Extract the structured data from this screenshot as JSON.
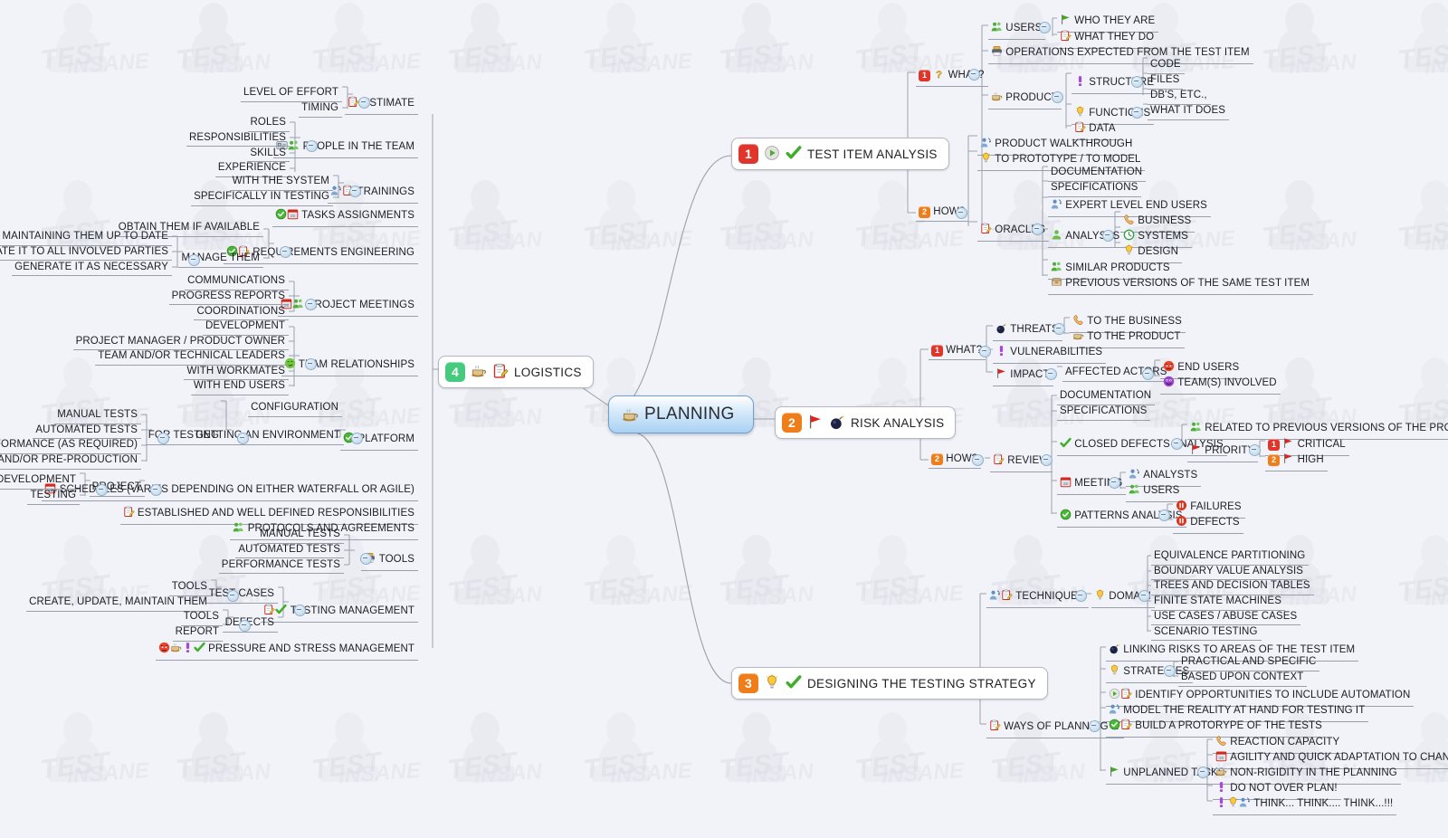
{
  "app": {
    "title": "PLANNING",
    "watermark_text": "TEST INSANE",
    "background_color": "#f2f3f8",
    "root_accent": "#a9d2f3"
  },
  "root": {
    "label": "PLANNING",
    "icon": "coffee-cup-icon"
  },
  "branches": [
    {
      "id": "test-item-analysis",
      "number": "1",
      "label": "TEST ITEM ANALYSIS",
      "icons": [
        "play-grey-icon",
        "check-green-icon"
      ],
      "badge_color": "#e0352b"
    },
    {
      "id": "risk-analysis",
      "number": "2",
      "label": "RISK ANALYSIS",
      "icons": [
        "flag-red-icon",
        "bomb-icon"
      ],
      "badge_color": "#ef7d1a"
    },
    {
      "id": "designing-the-testing-strategy",
      "number": "3",
      "label": "DESIGNING THE TESTING STRATEGY",
      "icons": [
        "lightbulb-icon",
        "check-green-icon"
      ],
      "badge_color": "#ef7d1a"
    },
    {
      "id": "logistics",
      "number": "4",
      "label": "LOGISTICS",
      "icons": [
        "coffee-cup-icon",
        "clipboard-icon"
      ],
      "badge_color": "#46cb7e"
    }
  ],
  "test_item_analysis": {
    "what": {
      "number": "1",
      "label": "WHAT?",
      "icon": "question-yellow-icon"
    },
    "users": {
      "label": "USERS",
      "icon": "users-green-icon"
    },
    "users_children": [
      {
        "label": "WHO THEY ARE",
        "icon": "flag-green-icon"
      },
      {
        "label": "WHAT THEY DO",
        "icon": "clipboard-icon"
      }
    ],
    "operations": {
      "label": "OPERATIONS EXPECTED FROM THE TEST ITEM",
      "icon": "printer-icon"
    },
    "product": {
      "label": "PRODUCT",
      "icon": "coffee-cup-icon"
    },
    "structure": {
      "label": "STRUCTURE",
      "icon": "exclam-purple-icon"
    },
    "structure_children": [
      {
        "label": "CODE"
      },
      {
        "label": "FILES"
      },
      {
        "label": "DB'S, ETC.,"
      }
    ],
    "functions": {
      "label": "FUNCTIONS",
      "icon": "lightbulb-icon"
    },
    "functions_children": [
      {
        "label": "WHAT IT DOES"
      }
    ],
    "data": {
      "label": "DATA",
      "icon": "clipboard-icon"
    },
    "how": {
      "number": "2",
      "label": "HOW?",
      "icon": "none"
    },
    "how_children": [
      {
        "label": "PRODUCT WALKTHROUGH",
        "icon": "presenter-icon"
      },
      {
        "label": "TO PROTOTYPE / TO MODEL",
        "icon": "lightbulb-icon"
      }
    ],
    "oracles": {
      "label": "ORACLES",
      "icon": "clipboard-icon"
    },
    "oracles_children": [
      {
        "label": "DOCUMENTATION",
        "icon": "none"
      },
      {
        "label": "SPECIFICATIONS",
        "icon": "none"
      },
      {
        "label": "EXPERT LEVEL END USERS",
        "icon": "presenter-icon"
      },
      {
        "label": "ANALYSTS",
        "icon": "person-green-icon"
      },
      {
        "label": "SIMILAR PRODUCTS",
        "icon": "users-green-icon"
      },
      {
        "label": "PREVIOUS VERSIONS OF THE SAME TEST ITEM",
        "icon": "archive-icon"
      }
    ],
    "analysts_children": [
      {
        "label": "BUSINESS",
        "icon": "phone-icon"
      },
      {
        "label": "SYSTEMS",
        "icon": "clock-green-icon"
      },
      {
        "label": "DESIGN",
        "icon": "lightbulb-icon"
      }
    ]
  },
  "risk_analysis": {
    "what": {
      "number": "1",
      "label": "WHAT?"
    },
    "threats": {
      "label": "THREATS",
      "icon": "bomb-icon"
    },
    "threats_children": [
      {
        "label": "TO THE BUSINESS",
        "icon": "phone-icon"
      },
      {
        "label": "TO THE PRODUCT",
        "icon": "coffee-cup-icon"
      }
    ],
    "vulnerabilities": {
      "label": "VULNERABILITIES",
      "icon": "exclam-purple-icon"
    },
    "impact": {
      "label": "IMPACT",
      "icon": "flag-red-icon"
    },
    "affected_actors": {
      "label": "AFFECTED ACTORS"
    },
    "affected_actors_children": [
      {
        "label": "END USERS",
        "icon": "smiley-angry-icon"
      },
      {
        "label": "TEAM(S) INVOLVED",
        "icon": "smiley-purple-icon"
      }
    ],
    "how": {
      "number": "2",
      "label": "HOW?"
    },
    "review": {
      "label": "REVIEW",
      "icon": "clipboard-icon"
    },
    "review_children": [
      {
        "label": "DOCUMENTATION",
        "icon": "none"
      },
      {
        "label": "SPECIFICATIONS",
        "icon": "none"
      },
      {
        "label": "CLOSED DEFECTS ANALYSIS",
        "icon": "check-green-icon"
      },
      {
        "label": "MEETING",
        "icon": "calendar-icon"
      },
      {
        "label": "PATTERNS ANALYSIS",
        "icon": "check-circle-green-icon"
      }
    ],
    "closed_defects_children": [
      {
        "label": "RELATED TO PREVIOUS VERSIONS OF THE PRODUCT",
        "icon": "users-green-icon"
      },
      {
        "label": "PRIORITY",
        "icon": "flag-red-icon"
      }
    ],
    "priority_children": [
      {
        "number": "1",
        "label": "CRITICAL",
        "icon": "flag-red-icon",
        "badge_color": "#e0352b"
      },
      {
        "number": "2",
        "label": "HIGH",
        "icon": "flag-red-icon",
        "badge_color": "#ef7d1a"
      }
    ],
    "meeting_children": [
      {
        "label": "ANALYSTS",
        "icon": "presenter-icon"
      },
      {
        "label": "USERS",
        "icon": "users-green-icon"
      }
    ],
    "patterns_children": [
      {
        "label": "FAILURES",
        "icon": "pause-red-icon"
      },
      {
        "label": "DEFECTS",
        "icon": "pause-red-icon"
      }
    ]
  },
  "strategy": {
    "techniques": {
      "label": "TECHNIQUES",
      "icons": [
        "presenter-icon",
        "clipboard-icon"
      ]
    },
    "domain": {
      "label": "DOMAIN",
      "icon": "lightbulb-icon"
    },
    "domain_children": [
      {
        "label": "EQUIVALENCE PARTITIONING"
      },
      {
        "label": "BOUNDARY VALUE ANALYSIS"
      },
      {
        "label": "TREES AND DECISION TABLES"
      },
      {
        "label": "FINITE STATE MACHINES"
      },
      {
        "label": "USE CASES / ABUSE CASES"
      },
      {
        "label": "SCENARIO TESTING"
      }
    ],
    "ways": {
      "label": "WAYS OF PLANNING IT",
      "icon": "clipboard-icon"
    },
    "ways_children": [
      {
        "label": "LINKING RISKS TO AREAS OF THE TEST ITEM",
        "icon": "bomb-icon"
      },
      {
        "label": "STRATEGIES",
        "icon": "lightbulb-icon"
      },
      {
        "label": "IDENTIFY OPPORTUNITIES TO INCLUDE AUTOMATION",
        "icons": [
          "play-green-icon",
          "clipboard-icon"
        ]
      },
      {
        "label": "MODEL THE REALITY AT HAND FOR TESTING IT",
        "icon": "presenter-icon"
      },
      {
        "label": "BUILD A PROTORYPE OF THE TESTS",
        "icons": [
          "check-circle-green-icon",
          "clipboard-icon"
        ]
      },
      {
        "label": "UNPLANNED TASKS",
        "icon": "flag-green-icon"
      }
    ],
    "strategies_children": [
      {
        "label": "PRACTICAL AND SPECIFIC"
      },
      {
        "label": "BASED UPON CONTEXT"
      }
    ],
    "unplanned_children": [
      {
        "label": "REACTION CAPACITY",
        "icon": "phone-icon"
      },
      {
        "label": "AGILITY AND QUICK ADAPTATION TO CHANGES",
        "icon": "calendar-icon"
      },
      {
        "label": "NON-RIGIDITY IN THE PLANNING",
        "icon": "coffee-cup-icon"
      },
      {
        "label": "DO NOT OVER PLAN!",
        "icon": "exclam-purple-icon"
      },
      {
        "label": "THINK... THINK.... THINK...!!!",
        "icons": [
          "exclam-purple-icon",
          "lightbulb-icon",
          "presenter-icon"
        ]
      }
    ]
  },
  "logistics": {
    "estimate": {
      "label": "ESTIMATE",
      "icon": "clipboard-icon"
    },
    "estimate_children": [
      {
        "label": "LEVEL OF EFFORT"
      },
      {
        "label": "TIMING"
      }
    ],
    "people": {
      "label": "PEOPLE IN THE TEAM",
      "icons": [
        "idcard-icon",
        "users-green-icon"
      ]
    },
    "people_children": [
      {
        "label": "ROLES"
      },
      {
        "label": "RESPONSIBILITIES"
      },
      {
        "label": "SKILLS"
      },
      {
        "label": "EXPERIENCE"
      }
    ],
    "trainings": {
      "label": "TRAININGS",
      "icons": [
        "presenter-icon",
        "clipboard-icon"
      ]
    },
    "trainings_children": [
      {
        "label": "WITH THE SYSTEM"
      },
      {
        "label": "SPECIFICALLY IN TESTING"
      }
    ],
    "tasks_assignments": {
      "label": "TASKS ASSIGNMENTS",
      "icons": [
        "check-circle-green-icon",
        "calendar-icon"
      ]
    },
    "requirements": {
      "label": "REQUIREMENTS ENGINEERING",
      "icons": [
        "check-circle-green-icon",
        "clipboard-icon"
      ]
    },
    "requirements_children": [
      {
        "label": "OBTAIN THEM IF AVAILABLE"
      },
      {
        "label": "MANAGE THEM"
      }
    ],
    "manage_them_children": [
      {
        "label": "MAINTAINING THEM UP TO DATE"
      },
      {
        "label": "COMMUNICATE IT TO ALL INVOLVED PARTIES"
      },
      {
        "label": "GENERATE IT AS NECESSARY"
      }
    ],
    "project_meetings": {
      "label": "PROJECT MEETINGS",
      "icons": [
        "calendar-icon",
        "users-green-icon"
      ]
    },
    "project_meetings_children": [
      {
        "label": "COMMUNICATIONS"
      },
      {
        "label": "PROGRESS REPORTS"
      },
      {
        "label": "COORDINATIONS"
      }
    ],
    "team_relationships": {
      "label": "TEAM RELATIONSHIPS",
      "icon": "smiley-green-icon"
    },
    "team_relationships_children": [
      {
        "label": "DEVELOPMENT"
      },
      {
        "label": "PROJECT MANAGER / PRODUCT OWNER"
      },
      {
        "label": "TEAM AND/OR TECHNICAL LEADERS"
      },
      {
        "label": "WITH WORKMATES"
      },
      {
        "label": "WITH END USERS"
      }
    ],
    "platform": {
      "label": "PLATFORM",
      "icon": "check-circle-green-icon"
    },
    "platform_children": [
      {
        "label": "FOR TESTING"
      },
      {
        "label": "GETTING AN ENVIRONMENT"
      }
    ],
    "for_testing_children": [
      {
        "label": "MANUAL TESTS"
      },
      {
        "label": "AUTOMATED TESTS"
      },
      {
        "label": "PERFORMANCE (AS REQUIRED)"
      },
      {
        "label": "UAT AND/OR PRE-PRODUCTION"
      }
    ],
    "environment_children": [
      {
        "label": "CONFIGURATION"
      }
    ],
    "schedules": {
      "label": "SCHEDULES (VARIES DEPENDING ON EITHER WATERFALL OR AGILE)",
      "icon": "calendar-icon"
    },
    "schedules_children": [
      {
        "label": "PROJECT"
      }
    ],
    "project_children": [
      {
        "label": "DEVELOPMENT"
      },
      {
        "label": "TESTING"
      }
    ],
    "responsibilities": {
      "label": "ESTABLISHED AND WELL DEFINED RESPONSIBILITIES",
      "icon": "clipboard-icon"
    },
    "protocols": {
      "label": "PROTOCOLS AND AGREEMENTS",
      "icon": "users-green-icon"
    },
    "tools": {
      "label": "TOOLS",
      "icon": "printer-icon"
    },
    "tools_children": [
      {
        "label": "MANUAL TESTS"
      },
      {
        "label": "AUTOMATED TESTS"
      },
      {
        "label": "PERFORMANCE TESTS"
      }
    ],
    "testing_management": {
      "label": "TESTING MANAGEMENT",
      "icons": [
        "clipboard-icon",
        "check-green-icon"
      ]
    },
    "testing_management_children": [
      {
        "label": "TEST CASES"
      },
      {
        "label": "DEFECTS"
      }
    ],
    "test_cases_children": [
      {
        "label": "TOOLS"
      },
      {
        "label": "CREATE, UPDATE, MAINTAIN THEM"
      }
    ],
    "defects_children": [
      {
        "label": "TOOLS"
      },
      {
        "label": "REPORT"
      }
    ],
    "pressure": {
      "label": "PRESSURE AND STRESS MANAGEMENT",
      "icons": [
        "smiley-angry-icon",
        "coffee-cup-icon",
        "exclam-purple-icon",
        "check-green-icon"
      ]
    }
  }
}
